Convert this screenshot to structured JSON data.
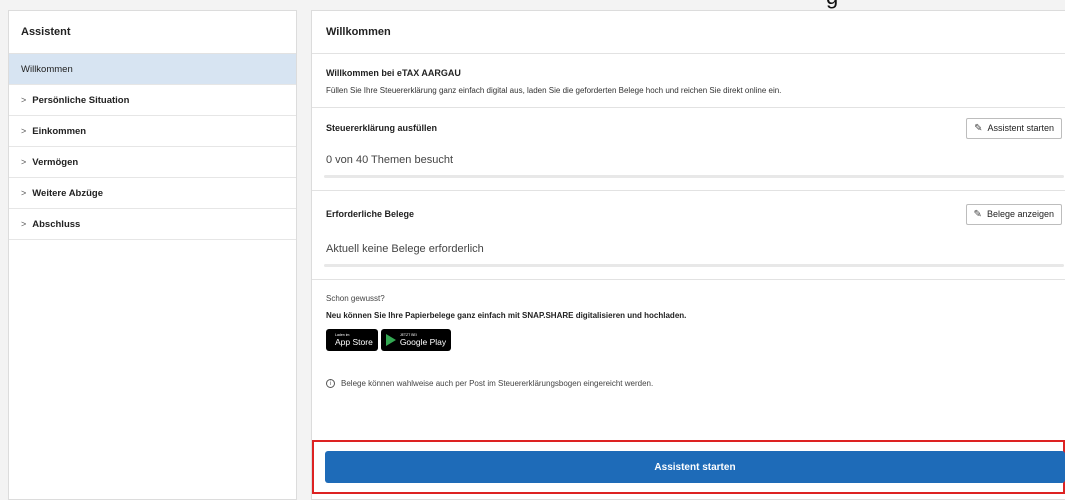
{
  "top_fragment": "g",
  "sidebar": {
    "title": "Assistent",
    "items": [
      {
        "label": "Willkommen",
        "active": true,
        "chevron": ""
      },
      {
        "label": "Persönliche Situation",
        "active": false,
        "chevron": ">"
      },
      {
        "label": "Einkommen",
        "active": false,
        "chevron": ">"
      },
      {
        "label": "Vermögen",
        "active": false,
        "chevron": ">"
      },
      {
        "label": "Weitere Abzüge",
        "active": false,
        "chevron": ">"
      },
      {
        "label": "Abschluss",
        "active": false,
        "chevron": ">"
      }
    ]
  },
  "main": {
    "title": "Willkommen",
    "welcome_title": "Willkommen bei eTAX AARGAU",
    "welcome_text": "Füllen Sie Ihre Steuererklärung ganz einfach digital aus, laden Sie die geforderten Belege hoch und reichen Sie direkt online ein.",
    "steuer_title": "Steuererklärung ausfüllen",
    "steuer_button": "Assistent starten",
    "steuer_status": "0 von 40 Themen besucht",
    "steuer_progress": 0,
    "belege_title": "Erforderliche Belege",
    "belege_button": "Belege anzeigen",
    "belege_status": "Aktuell keine Belege erforderlich",
    "belege_progress": 0,
    "info_small": "Schon gewusst?",
    "info_strong": "Neu können Sie Ihre Papierbelege ganz einfach mit SNAP.SHARE digitalisieren und hochladen.",
    "appstore_small": "Laden im",
    "appstore_big": "App Store",
    "googleplay_small": "JETZT BEI",
    "googleplay_big": "Google Play",
    "note_icon": "i",
    "note_text": "Belege können wahlweise auch per Post im Steuererklärungsbogen eingereicht werden.",
    "primary_button": "Assistent starten"
  },
  "icons": {
    "pencil": "pencil-icon",
    "info": "info-icon",
    "apple": "apple-icon",
    "play": "google-play-icon"
  },
  "colors": {
    "primary": "#1e6bb8",
    "active_item": "#d7e4f2",
    "highlight": "#dd2222"
  }
}
